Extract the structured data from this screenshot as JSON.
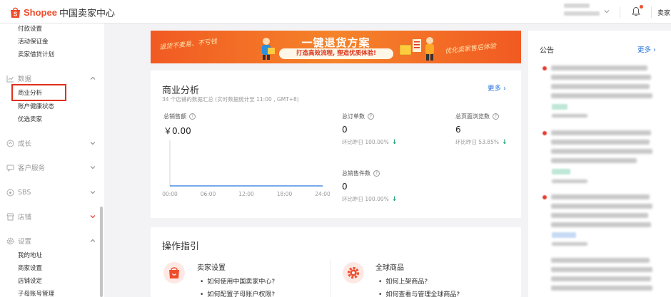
{
  "header": {
    "brand": "Shopee",
    "brand_suffix": "中国卖家中心",
    "seller_label": "卖家"
  },
  "sidebar": {
    "top_items": [
      "付款设置",
      "活动保证金",
      "卖家借贷计划"
    ],
    "groups": [
      {
        "label": "数据",
        "icon": "chart-icon",
        "expanded": true,
        "items": [
          "商业分析",
          "账户健康状态",
          "优选卖家"
        ]
      },
      {
        "label": "成长",
        "icon": "growth-icon",
        "expanded": false,
        "items": []
      },
      {
        "label": "客户服务",
        "icon": "chat-icon",
        "expanded": false,
        "items": []
      },
      {
        "label": "SBS",
        "icon": "warehouse-icon",
        "expanded": false,
        "items": []
      },
      {
        "label": "店铺",
        "icon": "store-icon",
        "expanded": false,
        "items": []
      },
      {
        "label": "设置",
        "icon": "gear-icon",
        "expanded": true,
        "items": [
          "我的地址",
          "商家设置",
          "店铺设定",
          "子母账号管理"
        ]
      }
    ],
    "selected_item": "商业分析"
  },
  "banner": {
    "left_slogan": "退货不麦易、不亏钱",
    "title": "一键退货方案",
    "subtitle": "打造高效流程, 塑造优质体验!",
    "right_slogan": "优化卖家售后体验"
  },
  "analytics": {
    "title": "商业分析",
    "subtitle": "34 个店铺的数据汇总 (实时数据统计至 11:00 , GMT+8)",
    "more_label": "更多",
    "metrics": [
      {
        "label": "总销售额",
        "value": "￥0.00",
        "compare": ""
      },
      {
        "label": "总订单数",
        "value": "0",
        "compare": "环比昨日 100.00%"
      },
      {
        "label": "总页面浏览数",
        "value": "6",
        "compare": "环比昨日 53.85%"
      },
      {
        "label": "总销售件数",
        "value": "0",
        "compare": "环比昨日 100.00%"
      }
    ]
  },
  "chart_data": {
    "type": "line",
    "categories": [
      "00:00",
      "06:00",
      "12:00",
      "18:00",
      "24:00"
    ],
    "values": [
      0,
      0,
      0,
      0,
      0
    ]
  },
  "guide": {
    "title": "操作指引",
    "sections": [
      {
        "title": "卖家设置",
        "icon": "shopping-bag-icon",
        "links": [
          "如何使用中国卖家中心?",
          "如何配置子母账户权限?"
        ]
      },
      {
        "title": "全球商品",
        "icon": "gear-icon",
        "links": [
          "如何上架商品?",
          "如何查看与管理全球商品?"
        ]
      }
    ]
  },
  "notice": {
    "title": "公告",
    "more_label": "更多"
  },
  "colors": {
    "brand": "#ee4d2d",
    "link": "#2673dd",
    "highlight_box": "#e0311e",
    "positive": "#1aa37a"
  }
}
